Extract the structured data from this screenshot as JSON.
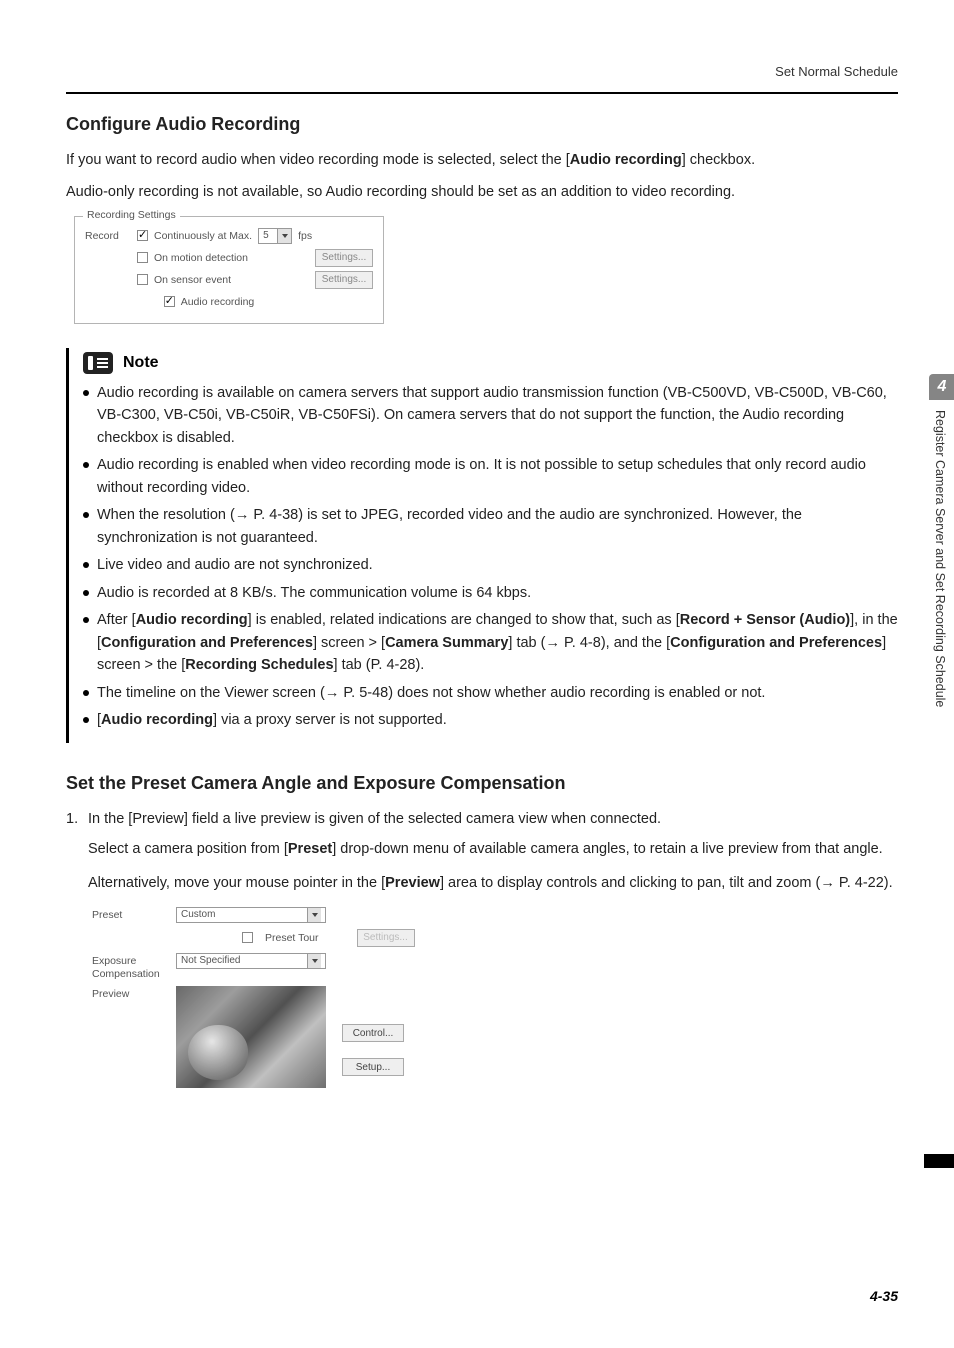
{
  "header": {
    "breadcrumb": "Set Normal Schedule"
  },
  "section1": {
    "heading": "Configure Audio Recording",
    "p1_a": "If you want to record audio when video recording mode is selected, select the [",
    "p1_b": "Audio recording",
    "p1_c": "] checkbox.",
    "p2": "Audio-only recording is not available, so Audio recording should be set as an addition to video recording."
  },
  "rec": {
    "legend": "Recording Settings",
    "record_label": "Record",
    "continuously": "Continuously at Max.",
    "fps_value": "5",
    "fps_unit": "fps",
    "motion": "On motion detection",
    "sensor": "On sensor event",
    "audio": "Audio recording",
    "settings_btn": "Settings..."
  },
  "note": {
    "title": "Note",
    "items": [
      "Audio recording is available on camera servers that support audio transmission function (VB-C500VD, VB-C500D, VB-C60, VB-C300, VB-C50i, VB-C50iR, VB-C50FSi). On camera servers that do not support the function, the Audio recording checkbox is disabled.",
      "Audio recording is enabled when video recording mode is on. It is not possible to setup schedules that only record audio without recording video.",
      "When the resolution (→ P. 4-38) is set to JPEG, recorded video and the audio are synchronized. However, the synchronization is not guaranteed.",
      "Live video and audio are not synchronized.",
      "Audio is recorded at 8 KB/s. The communication volume is 64 kbps."
    ],
    "item6_parts": [
      "After [",
      "Audio recording",
      "] is enabled, related indications are changed to show that, such as [",
      "Record + Sensor (Audio)",
      "], in the [",
      "Configuration and Preferences",
      "] screen > [",
      "Camera Summary",
      "] tab (→ P. 4-8), and the [",
      "Configuration and Preferences",
      "] screen > the [",
      "Recording Schedules",
      "] tab (P. 4-28)."
    ],
    "item7": "The timeline on the Viewer screen (→ P. 5-48) does not show whether audio recording is enabled or not.",
    "item8_parts": [
      "[",
      "Audio recording",
      "] via a proxy server is not supported."
    ]
  },
  "section2": {
    "heading": "Set the Preset Camera Angle and Exposure Compensation",
    "step_num": "1.",
    "step_text": "In the [Preview] field a live preview is given of the selected camera view when connected.",
    "p1_a": "Select a camera position from [",
    "p1_b": "Preset",
    "p1_c": "] drop-down menu of available camera angles, to retain a live preview from that angle.",
    "p2_a": "Alternatively, move your mouse pointer in the [",
    "p2_b": "Preview",
    "p2_c": "] area to display controls and clicking to pan, tilt and zoom (→ P. 4-22)."
  },
  "preset": {
    "preset_label": "Preset",
    "preset_value": "Custom",
    "preset_tour": "Preset Tour",
    "exposure_label": "Exposure Compensation",
    "exposure_value": "Not Specified",
    "preview_label": "Preview",
    "settings_btn": "Settings...",
    "control_btn": "Control...",
    "setup_btn": "Setup..."
  },
  "side": {
    "chapter": "4",
    "title": "Register Camera Server and Set Recording Schedule"
  },
  "footer": {
    "page": "4-35"
  }
}
